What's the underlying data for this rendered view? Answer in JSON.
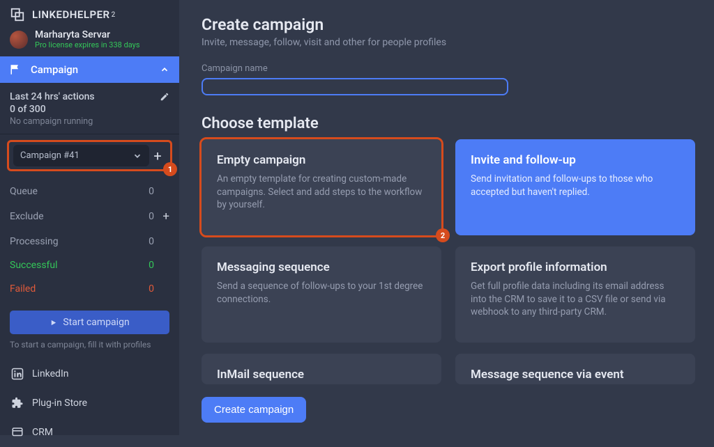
{
  "colors": {
    "accent": "#4d7cf6",
    "highlight": "#d64b1d",
    "success": "#34c759",
    "fail": "#e05a3a"
  },
  "brand": {
    "name": "LINKEDHELPER",
    "sup": "2"
  },
  "user": {
    "name": "Marharyta Servar",
    "license": "Pro license expires in 338 days"
  },
  "nav": {
    "campaign": "Campaign"
  },
  "stats": {
    "title": "Last 24 hrs' actions",
    "count": "0 of 300",
    "status": "No campaign running"
  },
  "campaign_selector": {
    "value": "Campaign #41",
    "marker": "1"
  },
  "statuses": [
    {
      "label": "Queue",
      "count": "0",
      "has_plus": false,
      "cls": "default"
    },
    {
      "label": "Exclude",
      "count": "0",
      "has_plus": true,
      "cls": "default"
    },
    {
      "label": "Processing",
      "count": "0",
      "has_plus": false,
      "cls": "default"
    },
    {
      "label": "Successful",
      "count": "0",
      "has_plus": false,
      "cls": "success"
    },
    {
      "label": "Failed",
      "count": "0",
      "has_plus": false,
      "cls": "failed"
    }
  ],
  "start_button": "Start campaign",
  "start_hint": "To start a campaign, fill it with profiles",
  "bottom_nav": [
    {
      "label": "LinkedIn",
      "icon": "linkedin-icon"
    },
    {
      "label": "Plug-in Store",
      "icon": "puzzle-icon"
    },
    {
      "label": "CRM",
      "icon": "crm-icon"
    }
  ],
  "page": {
    "title": "Create campaign",
    "subtitle": "Invite, message, follow, visit and other for people profiles",
    "name_label": "Campaign name",
    "name_value": "",
    "name_placeholder": ""
  },
  "choose_label": "Choose template",
  "templates": [
    {
      "title": "Empty campaign",
      "desc": "An empty template for creating custom-made campaigns. Select and add steps to the workflow by yourself.",
      "selected": false,
      "highlight": true
    },
    {
      "title": "Invite and follow-up",
      "desc": "Send invitation and follow-ups to those who accepted but haven't replied.",
      "selected": true,
      "highlight": false
    },
    {
      "title": "Messaging sequence",
      "desc": "Send a sequence of follow-ups to your 1st degree connections.",
      "selected": false,
      "highlight": false
    },
    {
      "title": "Export profile information",
      "desc": "Get full profile data including its email address into the CRM to save it to a CSV file or send via webhook to any third-party CRM.",
      "selected": false,
      "highlight": false
    },
    {
      "title": "InMail sequence",
      "desc": "",
      "selected": false,
      "highlight": false
    },
    {
      "title": "Message sequence via event",
      "desc": "",
      "selected": false,
      "highlight": false
    }
  ],
  "template_marker": "2",
  "create_button": "Create campaign"
}
